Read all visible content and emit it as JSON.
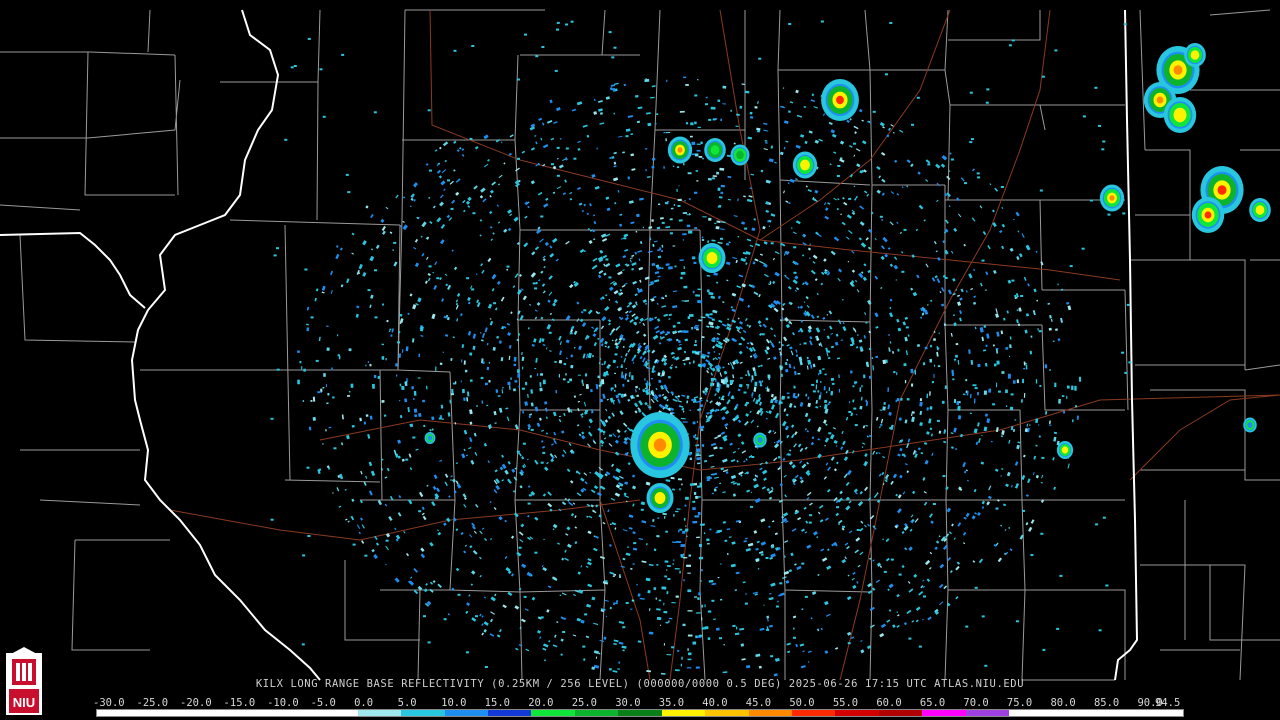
{
  "product": {
    "caption": "KILX LONG RANGE BASE REFLECTIVITY (0.25KM / 256 LEVEL) (000000/0000 0.5 DEG) 2025-06-26 17:15 UTC  ATLAS.NIU.EDU"
  },
  "legend": {
    "ticks": [
      "-30.0",
      "-25.0",
      "-20.0",
      "-15.0",
      "-10.0",
      "-5.0",
      "0.0",
      "5.0",
      "10.0",
      "15.0",
      "20.0",
      "25.0",
      "30.0",
      "35.0",
      "40.0",
      "45.0",
      "50.0",
      "55.0",
      "60.0",
      "65.0",
      "70.0",
      "75.0",
      "80.0",
      "85.0",
      "90.0",
      "94.5"
    ],
    "colors": [
      "#ffffff",
      "#ffffff",
      "#ffffff",
      "#ffffff",
      "#ffffff",
      "#ffffff",
      "#9ee8ee",
      "#29c7df",
      "#1e8ff0",
      "#1238d6",
      "#10e63a",
      "#0cb42d",
      "#0a8019",
      "#fff200",
      "#ffc400",
      "#ff8a00",
      "#ff2a00",
      "#d40000",
      "#b00000",
      "#ff00ff",
      "#a040e0",
      "#ffffff",
      "#ffffff",
      "#ffffff",
      "#ffffff"
    ]
  },
  "logo": {
    "text": "NIU"
  }
}
